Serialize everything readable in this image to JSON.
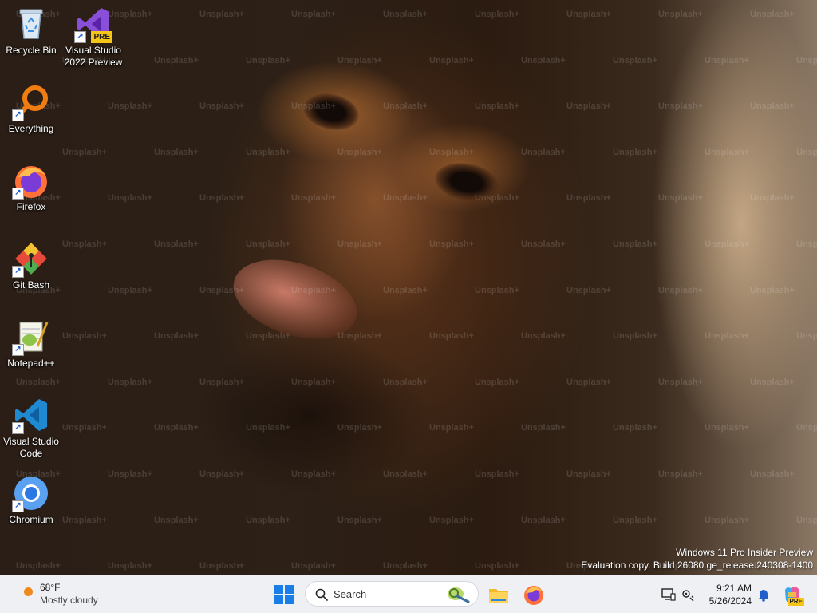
{
  "desktop": {
    "wallpaper_watermark": "Unsplash+",
    "icons": [
      {
        "label": "Recycle Bin",
        "icon": "recycle-bin-icon"
      },
      {
        "label": "Visual Studio 2022 Preview",
        "icon": "visual-studio-preview-icon",
        "badge": "PRE"
      },
      {
        "label": "Everything",
        "icon": "everything-search-icon"
      },
      {
        "label": "Firefox",
        "icon": "firefox-icon"
      },
      {
        "label": "Git Bash",
        "icon": "git-bash-icon"
      },
      {
        "label": "Notepad++",
        "icon": "notepad-plus-plus-icon"
      },
      {
        "label": "Visual Studio Code",
        "icon": "vscode-icon"
      },
      {
        "label": "Chromium",
        "icon": "chromium-icon"
      }
    ],
    "os_watermark": {
      "line1": "Windows 11 Pro Insider Preview",
      "line2": "Evaluation copy. Build 26080.ge_release.240308-1400"
    }
  },
  "taskbar": {
    "weather": {
      "temp": "68°F",
      "condition": "Mostly cloudy",
      "icon": "sun-icon"
    },
    "start_icon": "windows-logo-icon",
    "search": {
      "placeholder": "Search"
    },
    "pinned_apps": [
      "file-explorer-icon",
      "firefox-icon"
    ],
    "tray": {
      "icons": [
        "network-display-icon",
        "settings-accessibility-icon"
      ],
      "time": "9:21 AM",
      "date": "5/26/2024",
      "notification_icon": "bell-icon",
      "copilot_icon": "copilot-pre-icon",
      "copilot_badge": "PRE"
    }
  },
  "colors": {
    "taskbar_bg": "#eef0f4",
    "windows_blue": "#1a7ee8",
    "accent_orange": "#f08a1c"
  }
}
